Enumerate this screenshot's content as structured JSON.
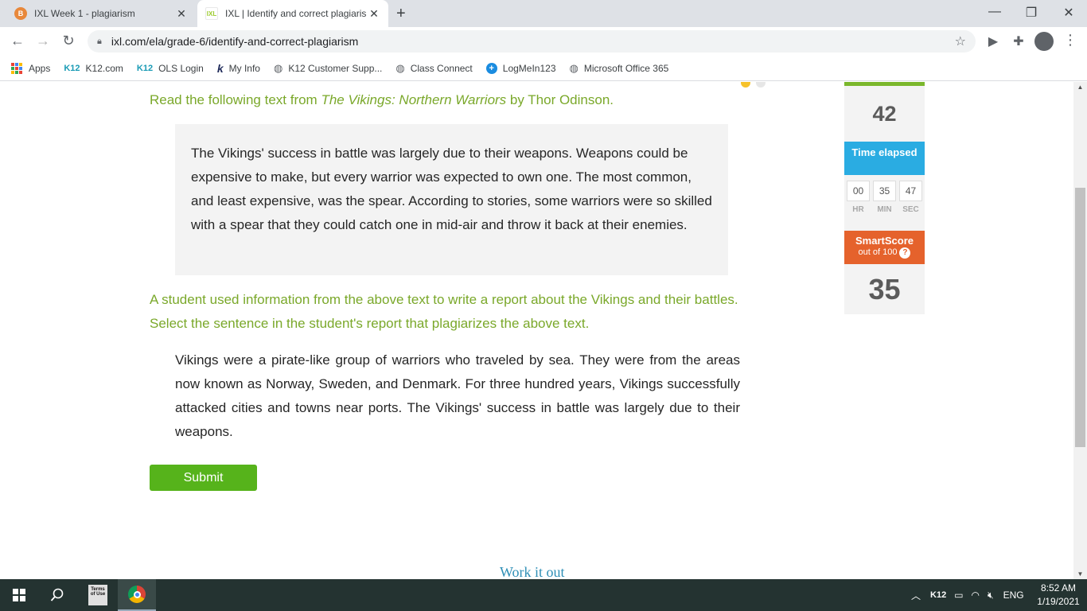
{
  "browser": {
    "tabs": [
      {
        "title": "IXL Week 1 - plagiarism",
        "favicon": "B",
        "active": false
      },
      {
        "title": "IXL | Identify and correct plagiaris",
        "favicon": "IXL",
        "active": true
      }
    ],
    "url": "ixl.com/ela/grade-6/identify-and-correct-plagiarism",
    "bookmarks": [
      {
        "label": "Apps",
        "icon": "apps-grid-icon"
      },
      {
        "label": "K12.com",
        "icon": "K12"
      },
      {
        "label": "OLS Login",
        "icon": "K12"
      },
      {
        "label": "My Info",
        "icon": "k12-script"
      },
      {
        "label": "K12 Customer Supp...",
        "icon": "globe-icon"
      },
      {
        "label": "Class Connect",
        "icon": "globe-icon"
      },
      {
        "label": "LogMeIn123",
        "icon": "plus-icon"
      },
      {
        "label": "Microsoft Office 365",
        "icon": "globe-icon"
      }
    ]
  },
  "question": {
    "prompt_prefix": "Read the following text from ",
    "source_title": "The Vikings: Northern Warriors",
    "prompt_suffix": " by Thor Odinson.",
    "passage": "The Vikings' success in battle was largely due to their weapons. Weapons could be expensive to make, but every warrior was expected to own one. The most common, and least expensive, was the spear. According to stories, some warriors were so skilled with a spear that they could catch one in mid-air and throw it back at their enemies.",
    "instruction": "A student used information from the above text to write a report about the Vikings and their battles. Select the sentence in the student's report that plagiarizes the above text.",
    "report_sentences": [
      "Vikings were a pirate-like group of warriors who traveled by sea.",
      "They were from the areas now known as Norway, Sweden, and Denmark.",
      "For three hundred years, Vikings successfully attacked cities and towns near ports.",
      "The Vikings' success in battle was largely due to their weapons."
    ],
    "submit_label": "Submit",
    "work_it_out_label": "Work it out"
  },
  "sidebar": {
    "questions_answered": "42",
    "time_label": "Time elapsed",
    "time": {
      "hr": "00",
      "min": "35",
      "sec": "47"
    },
    "time_units": {
      "hr": "HR",
      "min": "MIN",
      "sec": "SEC"
    },
    "smartscore_label": "SmartScore",
    "smartscore_sub": "out of 100",
    "smartscore": "35"
  },
  "taskbar": {
    "tray_k12": "K12",
    "language": "ENG",
    "time": "8:52 AM",
    "date": "1/19/2021",
    "terms_label": "Terms of Use"
  },
  "colors": {
    "prompt_green": "#7aa82a",
    "submit_green": "#56b31b",
    "time_blue": "#2aace2",
    "smartscore_orange": "#e5622c"
  }
}
